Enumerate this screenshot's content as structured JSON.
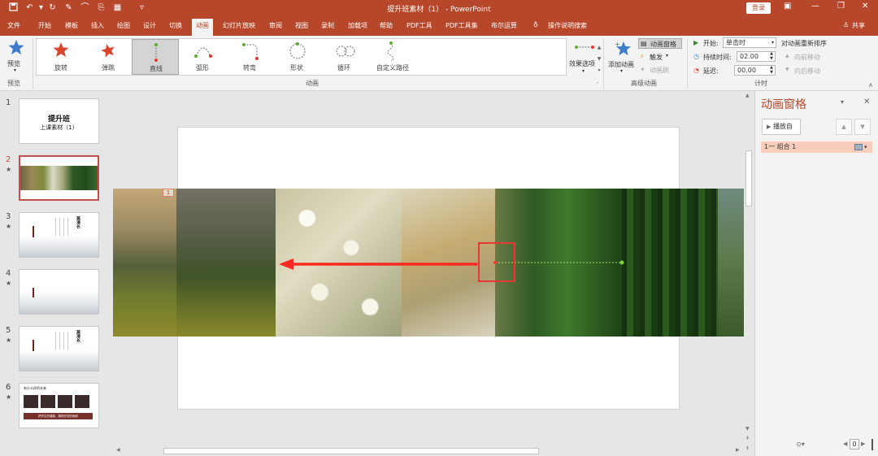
{
  "window": {
    "title": "提升班素材（1） - PowerPoint",
    "login": "登录",
    "share": "共享",
    "qat_icons": [
      "save-icon",
      "undo-icon",
      "redo-icon",
      "format-painter-icon",
      "brush-icon",
      "transfer-icon",
      "layout-icon",
      "customize-icon"
    ]
  },
  "tabs": [
    "文件",
    "开始",
    "模板",
    "插入",
    "绘图",
    "设计",
    "切换",
    "动画",
    "幻灯片放映",
    "审阅",
    "视图",
    "录制",
    "加载项",
    "帮助",
    "PDF工具",
    "PDF工具集",
    "布尔运算"
  ],
  "active_tab": "动画",
  "tell_me": "操作说明搜索",
  "ribbon": {
    "preview": "预览",
    "preview_group": "预览",
    "effects": [
      {
        "label": "旋转",
        "icon": "spin-star-icon"
      },
      {
        "label": "弹跳",
        "icon": "bounce-star-icon"
      },
      {
        "label": "直线",
        "icon": "line-path-icon",
        "selected": true
      },
      {
        "label": "弧形",
        "icon": "arc-path-icon"
      },
      {
        "label": "转弯",
        "icon": "turn-path-icon"
      },
      {
        "label": "形状",
        "icon": "shape-path-icon"
      },
      {
        "label": "循环",
        "icon": "loop-path-icon"
      },
      {
        "label": "自定义路径",
        "icon": "custom-path-icon"
      }
    ],
    "effect_options": "效果选项",
    "anim_group": "动画",
    "add_animation": "添加动画",
    "anim_pane": "动画窗格",
    "trigger": "触发",
    "anim_painter": "动画刷",
    "advanced_group": "高级动画",
    "start_label": "开始:",
    "start_value": "单击时",
    "duration_label": "持续时间:",
    "duration_value": "02.00",
    "delay_label": "延迟:",
    "delay_value": "00.00",
    "reorder": "对动画重新排序",
    "move_earlier": "向前移动",
    "move_later": "向后移动",
    "timing_group": "计时"
  },
  "slides": [
    {
      "num": "1",
      "star": "",
      "title": "提升班",
      "subtitle": "上课素材（1）"
    },
    {
      "num": "2",
      "star": "★"
    },
    {
      "num": "3",
      "star": "★",
      "heading": "莫滑长"
    },
    {
      "num": "4",
      "star": "★"
    },
    {
      "num": "5",
      "star": "★",
      "heading": "莫滑长"
    },
    {
      "num": "6",
      "star": "★",
      "heading": "有什么样的未来",
      "footer": "把学生的潜能，展现在您的面前"
    }
  ],
  "current_slide": "2",
  "stage": {
    "anim_tag": "1"
  },
  "anim_pane": {
    "title": "动画窗格",
    "play_from": "播放自",
    "item": "1一 组合 1"
  },
  "statusbar": {
    "zoom_box": "0"
  },
  "colors": {
    "accent": "#b7472a",
    "path_arrow": "#ff2a1f",
    "path_line": "#7fd43a",
    "selection_box": "#e53935",
    "anim_item_bg": "#f9cdbb"
  }
}
